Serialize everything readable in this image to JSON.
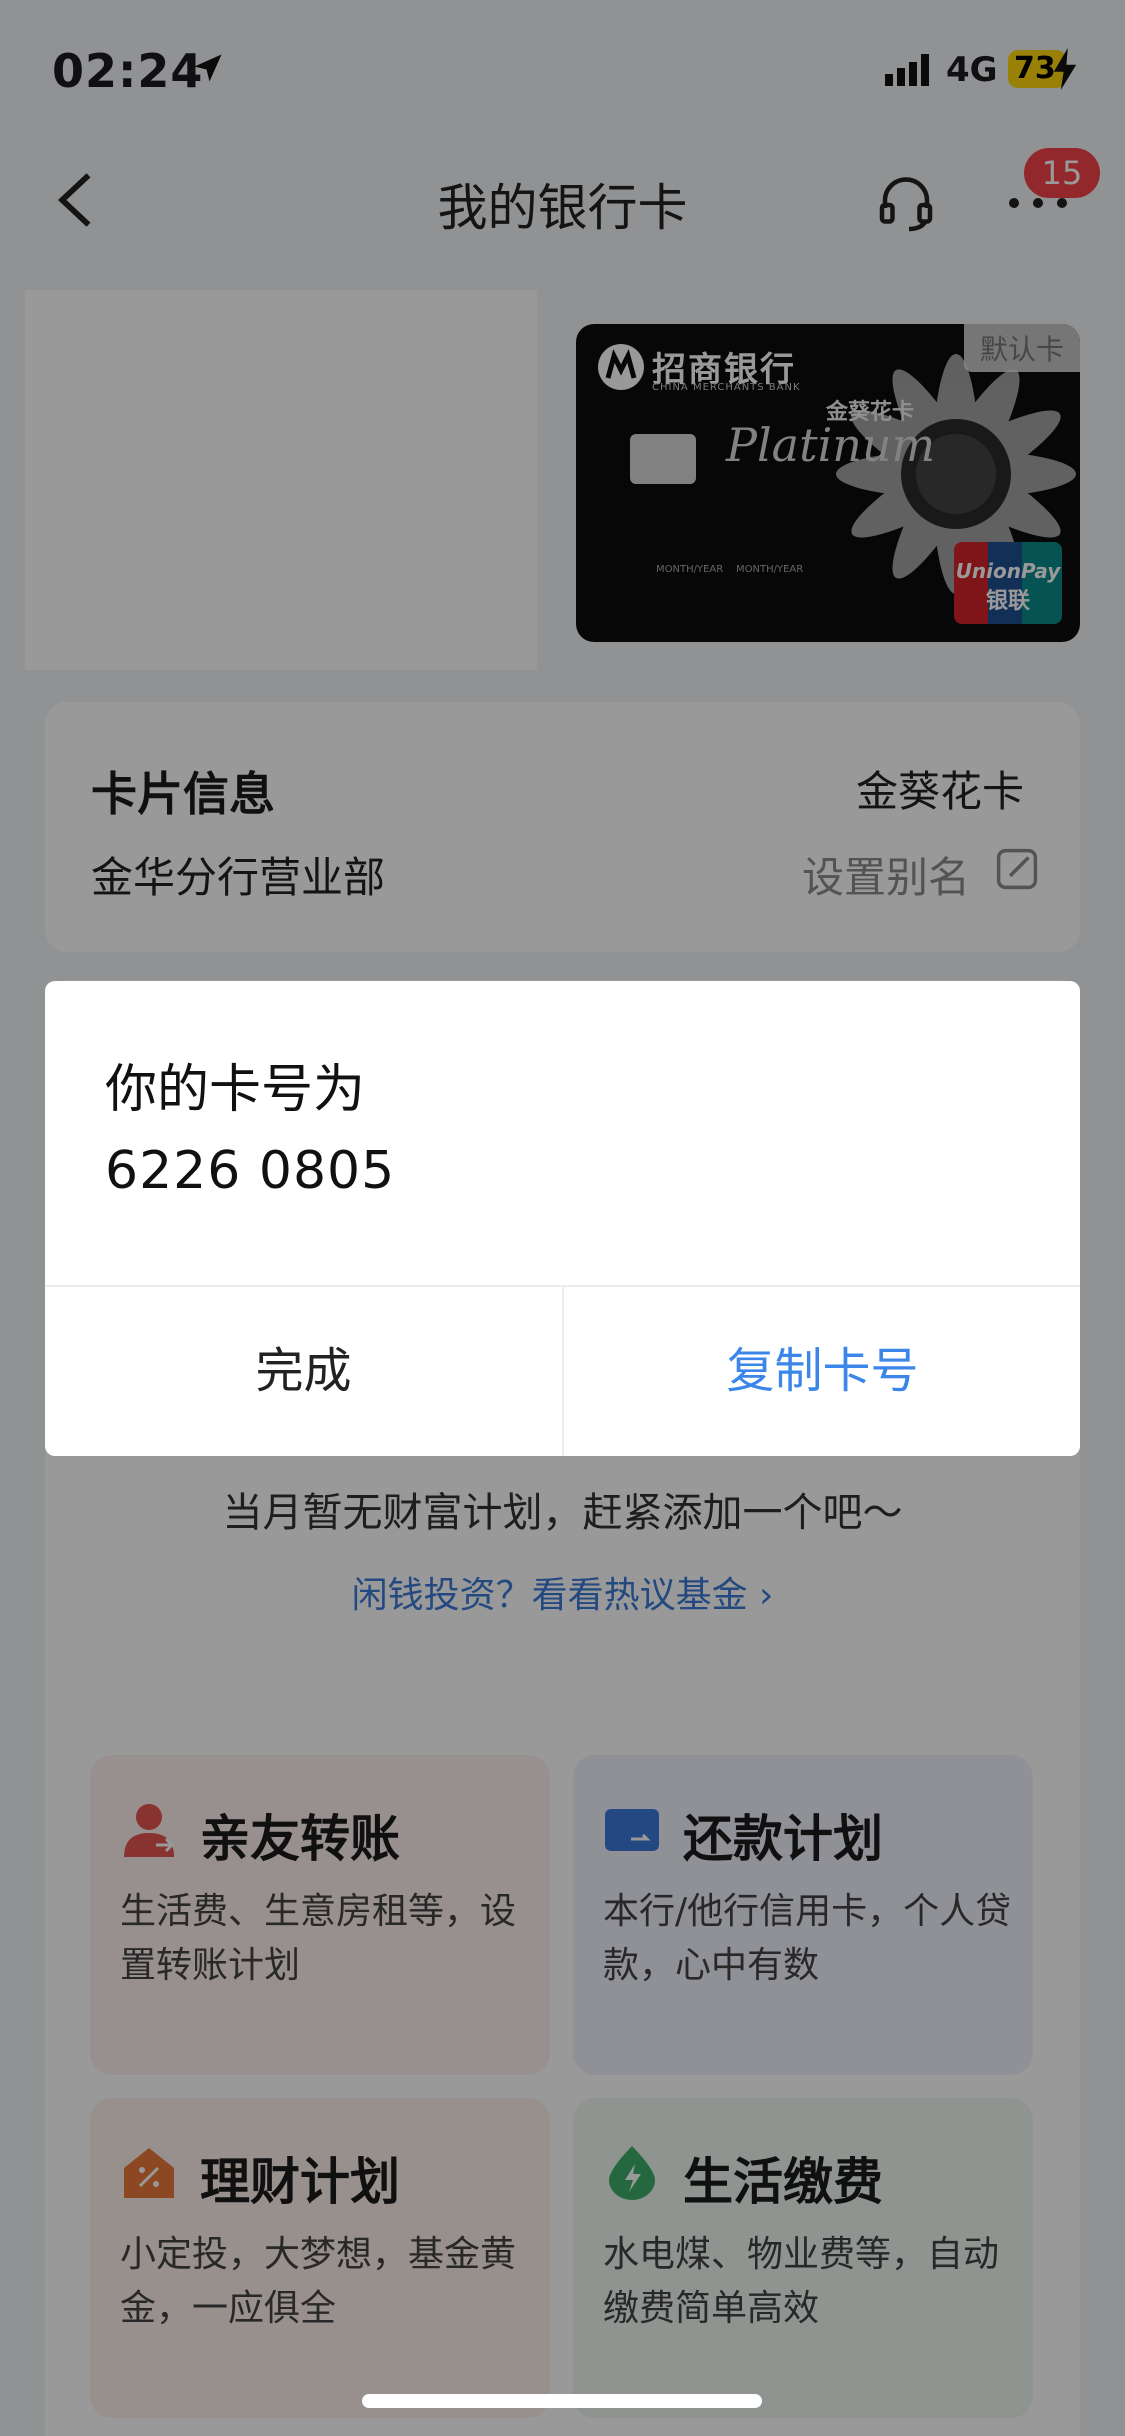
{
  "status_bar": {
    "time": "02:24",
    "network": "4G",
    "battery": "73"
  },
  "nav": {
    "title": "我的银行卡",
    "badge": "15"
  },
  "bank_card": {
    "bank_name": "招商银行",
    "bank_name_en": "CHINA MERCHANTS BANK",
    "card_type": "金葵花卡",
    "tier": "Platinum",
    "default_tag": "默认卡",
    "valid_from": "MONTH/YEAR",
    "valid_thru": "MONTH/YEAR",
    "network": "UnionPay 银联"
  },
  "card_info": {
    "title": "卡片信息",
    "card_type": "金葵花卡",
    "branch": "金华分行营业部",
    "alias_label": "设置别名"
  },
  "plan": {
    "empty_text": "当月暂无财富计划，赶紧添加一个吧～",
    "invest_link": "闲钱投资？看看热议基金 ›"
  },
  "features": [
    {
      "title": "亲友转账",
      "desc": "生活费、生意房租等，设置转账计划"
    },
    {
      "title": "还款计划",
      "desc": "本行/他行信用卡，个人贷款，心中有数"
    },
    {
      "title": "理财计划",
      "desc": "小定投，大梦想，基金黄金，一应俱全"
    },
    {
      "title": "生活缴费",
      "desc": "水电煤、物业费等，自动缴费简单高效"
    }
  ],
  "dialog": {
    "title": "你的卡号为",
    "card_number": "6226 0805",
    "done_label": "完成",
    "copy_label": "复制卡号"
  },
  "colors": {
    "accent": "#3b86e8",
    "badge": "#f4424a",
    "battery": "#ffd60a"
  }
}
